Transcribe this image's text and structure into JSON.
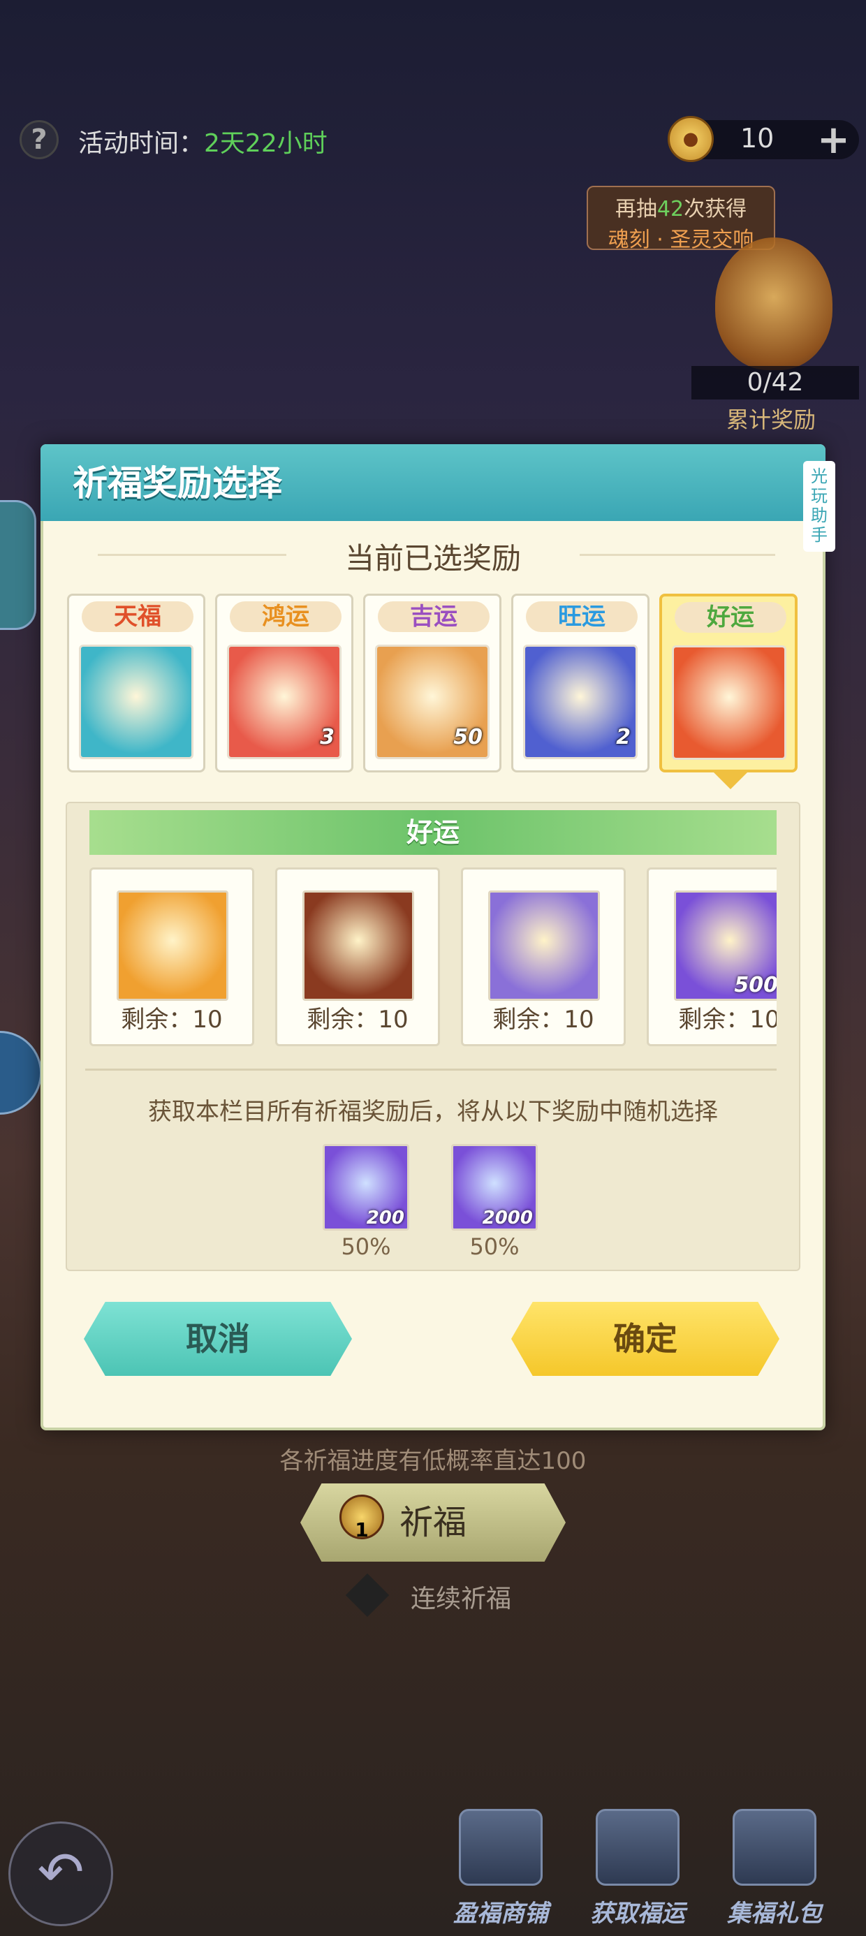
{
  "top": {
    "help_icon": "question-icon",
    "event_label": "活动时间：",
    "event_time": "2天22小时",
    "currency_count": "10",
    "plus_icon": "+"
  },
  "draw_hint": {
    "prefix": "再抽",
    "count": "42",
    "suffix": "次获得",
    "reward": "魂刻 · 圣灵交响"
  },
  "accumulate": {
    "progress": "0/42",
    "label": "累计奖励"
  },
  "dialog": {
    "title": "祈福奖励选择",
    "side_tag": "光玩助手",
    "section_title": "当前已选奖励",
    "selected": [
      {
        "tier": "天福",
        "tier_color": "#e0502a",
        "icon": "helmet-icon",
        "qty": "",
        "bg": "#3fb6c8"
      },
      {
        "tier": "鸿运",
        "tier_color": "#e89020",
        "icon": "blade-icon",
        "qty": "3",
        "bg": "#e85a4a"
      },
      {
        "tier": "吉运",
        "tier_color": "#9a4fc0",
        "icon": "wings-icon",
        "qty": "50",
        "bg": "#e8a050"
      },
      {
        "tier": "旺运",
        "tier_color": "#2a9ae0",
        "icon": "rune-icon",
        "qty": "2",
        "bg": "#5060d0"
      },
      {
        "tier": "好运",
        "tier_color": "#4ea83e",
        "icon": "armor-icon",
        "qty": "",
        "bg": "#e85a30"
      }
    ],
    "pool_title": "好运",
    "pool": [
      {
        "icon": "amulet-icon",
        "qty": "",
        "bg": "#f0a030",
        "remain": "剩余：10"
      },
      {
        "icon": "armor-check-icon",
        "qty": "",
        "bg": "#8a3a20",
        "remain": "剩余：10"
      },
      {
        "icon": "orb-pedestal-icon",
        "qty": "",
        "bg": "#8a70d8",
        "remain": "剩余：10"
      },
      {
        "icon": "potion-icon",
        "qty": "500",
        "bg": "#7a50d8",
        "remain": "剩余：10"
      }
    ],
    "note": "获取本栏目所有祈福奖励后，将从以下奖励中随机选择",
    "random": [
      {
        "icon": "potion-icon",
        "qty": "200",
        "pct": "50%",
        "bg": "#7a50d8"
      },
      {
        "icon": "crystal-icon",
        "qty": "2000",
        "pct": "50%",
        "bg": "#7a50d8"
      }
    ],
    "cancel_label": "取消",
    "ok_label": "确定"
  },
  "bottom": {
    "pity_note": "各祈福进度有低概率直达100",
    "pray_label": "祈福",
    "pray_cost": "1",
    "continuous_label": "连续祈福",
    "nav": [
      {
        "label": "盈福商铺",
        "icon": "shop-icon"
      },
      {
        "label": "获取福运",
        "icon": "book-icon"
      },
      {
        "label": "集福礼包",
        "icon": "gift-icon"
      }
    ]
  }
}
